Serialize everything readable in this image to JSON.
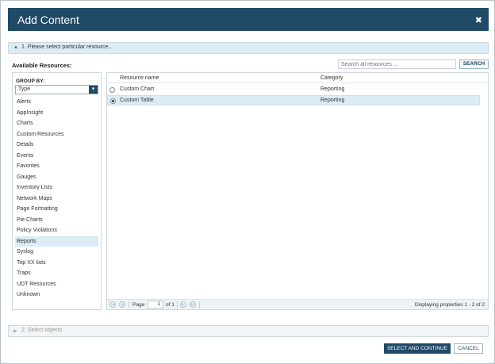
{
  "dialog": {
    "title": "Add Content",
    "close_glyph": "✖"
  },
  "steps": [
    {
      "label": "1. Please select particular resource...",
      "arrow": "▲"
    },
    {
      "label": "2. Select objects",
      "arrow": "▶"
    }
  ],
  "available_label": "Available Resources:",
  "search": {
    "placeholder": "Search all resources ...",
    "button": "SEARCH"
  },
  "group_by": {
    "label": "GROUP BY:",
    "selected": "Type",
    "items": [
      "Alerts",
      "AppInsight",
      "Charts",
      "Custom Resources",
      "Details",
      "Events",
      "Favorites",
      "Gauges",
      "Inventory Lists",
      "Network Maps",
      "Page Formatting",
      "Pie Charts",
      "Policy Violations",
      "Reports",
      "Syslog",
      "Top XX lists",
      "Traps",
      "UDT Resources",
      "Unknown"
    ],
    "selected_item": "Reports"
  },
  "table": {
    "columns": [
      "Resource name",
      "Category"
    ],
    "rows": [
      {
        "name": "Custom Chart",
        "category": "Reporting",
        "selected": false
      },
      {
        "name": "Custom Table",
        "category": "Reporting",
        "selected": true
      }
    ]
  },
  "pager": {
    "page_label": "Page",
    "page_value": "1",
    "of_label": "of 1",
    "info": "Displaying properties 1 - 2 of 2"
  },
  "footer": {
    "primary": "SELECT AND CONTINUE",
    "cancel": "CANCEL"
  },
  "colors": {
    "header": "#204a66",
    "selected_row": "#dcecf6"
  }
}
